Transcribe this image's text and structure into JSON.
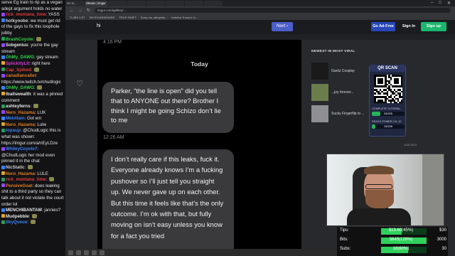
{
  "browser": {
    "tabs": [
      {
        "label": "Go to... ",
        "active": false
      },
      {
        "label": "Stream | Imgur",
        "active": true
      },
      {
        "label": "",
        "active": false
      },
      {
        "label": "",
        "active": false
      },
      {
        "label": "",
        "active": false
      },
      {
        "label": "",
        "active": false
      },
      {
        "label": "",
        "active": false
      },
      {
        "label": "",
        "active": false
      }
    ],
    "url": "imgur.com/gallery/...",
    "bookmarks": [
      "TLJBS LIST",
      "SM SOUNDBOARD",
      "TRUE SWIFT",
      "Sorry ma, allegedly...",
      "Indicted Trump's In..."
    ]
  },
  "header": {
    "title": "hi",
    "next_label": "Next",
    "next_icon": "chevron-right",
    "adfree_label": "Go Ad-Free",
    "signin_label": "Sign In",
    "signup_label": "Sign up"
  },
  "post": {
    "time_top": "4:16 PM",
    "today": "Today",
    "message1": "Parker, “the line is open” did you tell that to ANYONE out there? Brother I think I might be going Schizo don’t lie to me",
    "time_mid": "12:26 AM",
    "message2": "I don’t really care if this leaks, fuck it. Everyone already knows I’m a fucking pushover so I’ll just tell you straight up. We never gave up on each other. But this time it feels like that’s the only outcome. I’m ok with that, but fully moving on isn’t easy unless you know for a fact you tried"
  },
  "viral": {
    "title": "NEWEST IN MOST VIRAL",
    "items": [
      {
        "label": "Gantz Cosplay"
      },
      {
        "label": "...joy forever..."
      },
      {
        "label": "Sucky Fingerflip to ..."
      }
    ]
  },
  "qr": {
    "title": "QR SCAN",
    "line1": "COMPLETE TUTORIAL",
    "bar1_value": "53/205",
    "bar1_fraction": 0.26,
    "line2": "REACH POWER LVL 10",
    "bar2_value": "23/205",
    "bar2_fraction": 0.11,
    "date": "1/28 2023"
  },
  "goals": [
    {
      "label": "Tips:",
      "value": "$13.60(45%)",
      "target": "$30",
      "fraction": 0.45
    },
    {
      "label": "Bits:",
      "value": "3845(128%)",
      "target": "3000",
      "fraction": 1.0
    },
    {
      "label": "Subs:",
      "value": "18(60%)",
      "target": "30",
      "fraction": 0.6
    }
  ],
  "chat": [
    {
      "user": "",
      "text": "serve Eg train to rip as a vegan adept argument holds no water",
      "color": "#e6e6e6"
    },
    {
      "user": "rick_montana_time",
      "text": "YASS",
      "color": "#e23b3b"
    },
    {
      "user": "hotkyoobe",
      "text": "we must get rid of the gays to fix this loophole",
      "color": "#d0d0d0"
    },
    {
      "user": "",
      "text": "jubby",
      "color": "#e6e6e6"
    },
    {
      "user": "BrashCoyote",
      "text": "",
      "color": "#33d14a"
    },
    {
      "user": "Sobgenius",
      "text": "you're the gay stream",
      "color": "#e6e6e6"
    },
    {
      "user": "OhMy_DAWG",
      "text": "gay stream",
      "color": "#33d14a"
    },
    {
      "user": "SplickityLit",
      "text": "right here",
      "color": "#d93bd9"
    },
    {
      "user": "Cap_Spiked",
      "text": "",
      "color": "#e23b3b"
    },
    {
      "user": "canadiancaller",
      "text": "https://www.twitch.tv/chudlogic",
      "color": "#e07a1f"
    },
    {
      "user": "OhMy_DAWG",
      "text": "",
      "color": "#33d14a"
    },
    {
      "user": "tballswealth",
      "text": "it was a pinned comment",
      "color": "#e6e6e6"
    },
    {
      "user": "ashleyferns",
      "text": "",
      "color": "#e6e6e6"
    },
    {
      "user": "Nero_Hazama",
      "text": "LUK",
      "color": "#e07a1f"
    },
    {
      "user": "Melvitain",
      "text": "Got em",
      "color": "#3b82f6"
    },
    {
      "user": "Nero_Hazama",
      "text": "Lulw",
      "color": "#e07a1f"
    },
    {
      "user": "topsup",
      "text": "@ChudLogic this is what was shown: https://imgur.com/a/nEyLDze",
      "color": "#3b82f6"
    },
    {
      "user": "WhileyCoyote7",
      "text": "@ChudLogic her mod even pinned it in the chat",
      "color": "#3b82f6"
    },
    {
      "user": "NicStatic",
      "text": "",
      "color": "#d0d0d0"
    },
    {
      "user": "Nero_Hazama",
      "text": "LULE",
      "color": "#e07a1f"
    },
    {
      "user": "rick_montana_time",
      "text": "",
      "color": "#e23b3b"
    },
    {
      "user": "PensiveGoat",
      "text": "does leaking shit to a third party so they can talk about it not violate the court order lol",
      "color": "#e07a1f"
    },
    {
      "user": "MENCHIBANTAM",
      "text": "jannies?",
      "color": "#e6e6e6"
    },
    {
      "user": "Mudpebble",
      "text": "",
      "color": "#e6e6e6"
    },
    {
      "user": "SkyQueue",
      "text": "",
      "color": "#3b82f6"
    }
  ],
  "colors": {
    "accent_next": "#4b5ec9",
    "accent_adfree": "#2747b9",
    "accent_signup": "#1bb76e",
    "bubble": "#3a3a3d",
    "goal_fill": "#2fd15c"
  }
}
